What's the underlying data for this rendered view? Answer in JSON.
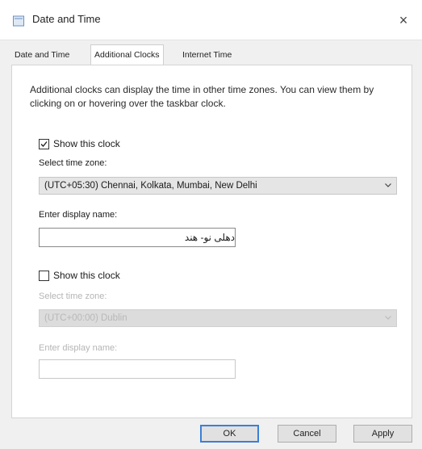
{
  "window": {
    "title": "Date and Time",
    "close_glyph": "×"
  },
  "tabs": [
    {
      "label": "Date and Time"
    },
    {
      "label": "Additional Clocks"
    },
    {
      "label": "Internet Time"
    }
  ],
  "description": "Additional clocks can display the time in other time zones. You can view them by clicking on or hovering over the taskbar clock.",
  "clock1": {
    "show_label": "Show this clock",
    "checked": true,
    "timezone_label": "Select time zone:",
    "timezone_value": "(UTC+05:30) Chennai, Kolkata, Mumbai, New Delhi",
    "display_name_label": "Enter display name:",
    "display_name_value": "دهلی نو- هند"
  },
  "clock2": {
    "show_label": "Show this clock",
    "checked": false,
    "timezone_label": "Select time zone:",
    "timezone_value": "(UTC+00:00) Dublin",
    "display_name_label": "Enter display name:",
    "display_name_value": ""
  },
  "buttons": {
    "ok": "OK",
    "cancel": "Cancel",
    "apply": "Apply"
  },
  "colors": {
    "accent": "#3c7fd6",
    "check": "#1a1a1a"
  },
  "icons": {
    "app": "clock-window-icon",
    "close": "close-icon",
    "dropdown": "chevron-down-icon",
    "check": "check-icon"
  }
}
